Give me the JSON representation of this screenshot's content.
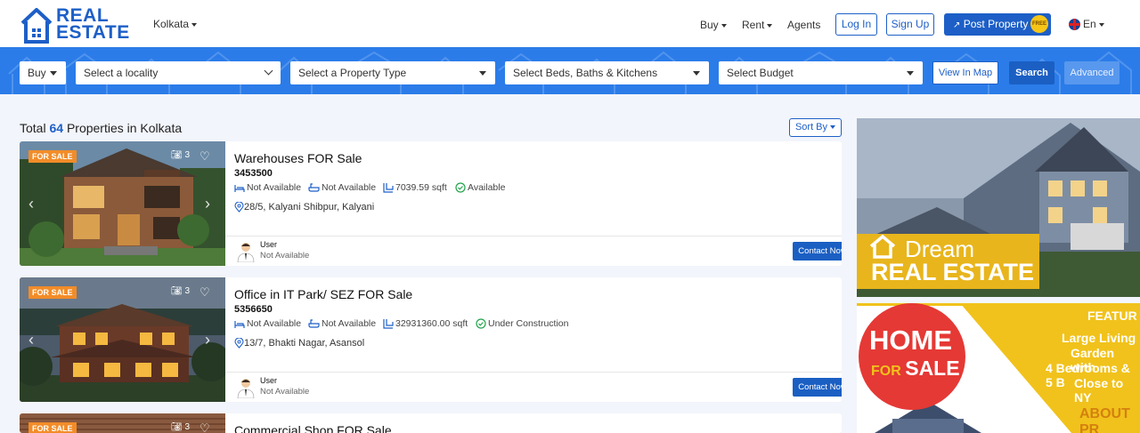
{
  "brand": {
    "line1": "REAL",
    "line2": "ESTATE"
  },
  "header": {
    "city": "Kolkata",
    "nav": [
      "Buy",
      "Rent",
      "Agents"
    ],
    "login": "Log In",
    "signup": "Sign Up",
    "post": "Post Property",
    "post_badge": "FREE",
    "lang": "En"
  },
  "search": {
    "mode": "Buy",
    "locality": "Select a locality",
    "property_type": "Select a Property Type",
    "beds": "Select Beds, Baths & Kitchens",
    "budget": "Select Budget",
    "view_map": "View In Map",
    "search": "Search",
    "advanced": "Advanced"
  },
  "results": {
    "prefix": "Total",
    "count": "64",
    "suffix": "Properties in Kolkata",
    "sort": "Sort By"
  },
  "listings": [
    {
      "tag": "FOR SALE",
      "photos": "3",
      "title": "Warehouses FOR Sale",
      "price": "3453500",
      "beds": "Not Available",
      "baths": "Not Available",
      "area": "7039.59 sqft",
      "status": "Available",
      "address": "28/5, Kalyani Shibpur, Kalyani",
      "user": "User",
      "user_sub": "Not Available",
      "contact": "Contact Now"
    },
    {
      "tag": "FOR SALE",
      "photos": "3",
      "title": "Office in IT Park/ SEZ FOR Sale",
      "price": "5356650",
      "beds": "Not Available",
      "baths": "Not Available",
      "area": "32931360.00 sqft",
      "status": "Under Construction",
      "address": "13/7, Bhakti Nagar, Asansol",
      "user": "User",
      "user_sub": "Not Available",
      "contact": "Contact Now"
    },
    {
      "tag": "FOR SALE",
      "photos": "3",
      "title": "Commercial Shop FOR Sale"
    }
  ],
  "ads": {
    "ad1": {
      "line1": "Dream",
      "line2": "REAL ESTATE"
    },
    "ad2": {
      "home": "HOME",
      "for": "FOR",
      "sale": "SALE",
      "features": "FEATUR",
      "l1": "Large Living",
      "l2": "Garden with",
      "l3": "4 Bedrooms & 5 B",
      "l4": "Close to NY",
      "about": "ABOUT PR"
    }
  },
  "colors": {
    "brand": "#1d5fc7",
    "bar": "#2b7ce9",
    "tag": "#f28c28",
    "ok": "#21a34a"
  }
}
